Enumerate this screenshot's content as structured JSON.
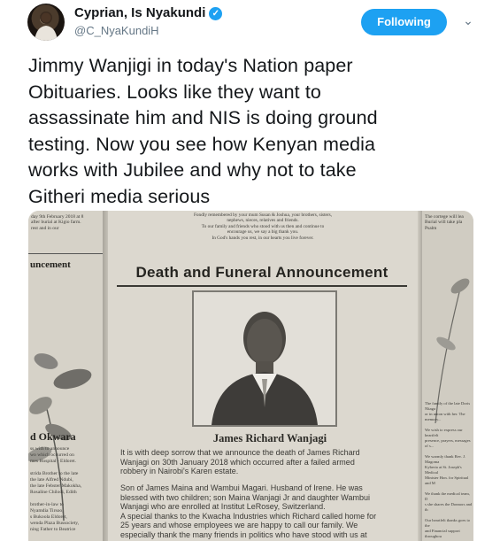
{
  "author": {
    "name": "Cyprian, Is Nyakundi",
    "handle": "@C_NyaKundiH",
    "verified_glyph": "✓"
  },
  "follow_button": {
    "label": "Following"
  },
  "menu": {
    "chevron_glyph": "⌄"
  },
  "tweet": {
    "text": "Jimmy Wanjigi in today's Nation paper\nObituaries. Looks like they want to\nassassinate him and NIS is doing ground\ntesting. Now you see how Kenyan media\nworks with Jubilee and why not to take\nGitheri media serious"
  },
  "newspaper": {
    "top_left": "day 9th February 2018 at 8\nafter burial at Kigio farm.\nrest and in our",
    "top_center": "Fondly remembered by your mum Susan & Joshua, your brothers, sisters,\nnephews, nieces, relatives and friends.\nTo our family and friends who stood with us then and continue to\nencourage us, we say a big thank you.\nIn God's hands you rest, in our hearts you live forever.",
    "top_right": "The cortege will lea\nBurial will take pla\nPsalm",
    "left_heading": "uncement",
    "left_heading2": "d Okwara",
    "left_body": "ss with to announce\nwo which occurred on\nmes Hospital - Eldoret.\n\nstrida Brother to the late\nthe late Alfred Ndubi,\nthe late Febster Makokha,\nRosaline Chilodi, Edith\n\nbrother-in-law to\nNyamdia Tirsoo,\ns Bukoola Eldoret,\nwenda Plaza Bussociety,\nning Father to Beatrice",
    "right_body": "The family of the late Doris Nkaga\nor in union with her. The memory...\n\nWe wish to express our heartfelt\npresence, prayers, messages of s...\n\nWe warmly thank Rev. J. Magoma\nKyberia at St. Joseph's Medical\nMinister Hon. for Spiritual and M\n\nWe thank the medical team, D\ns she shares the Donnors and th\n\nOur heartfelt thanks goes to the\nand Financial support throughou",
    "headline": "Death and Funeral Announcement",
    "deceased_name": "James Richard Wanjagi",
    "para1": "It is with deep sorrow that we announce the death of James Richard\nWanjagi on 30th January 2018 which occurred after a failed armed\nrobbery in Nairobi's Karen estate.",
    "para2": "Son of James Maina and Wambui Magari. Husband of Irene. He was\nblessed with two children; son Maina Wanjagi Jr and daughter Wambui\nWanjagi who are enrolled at Institut LeRosey, Switzerland.\nA special thanks to the Kwacha Industries which Richard called home for\n25 years and whose employees we are happy to call our family. We\nespecially thank the many friends in politics who have stood with us at"
  }
}
